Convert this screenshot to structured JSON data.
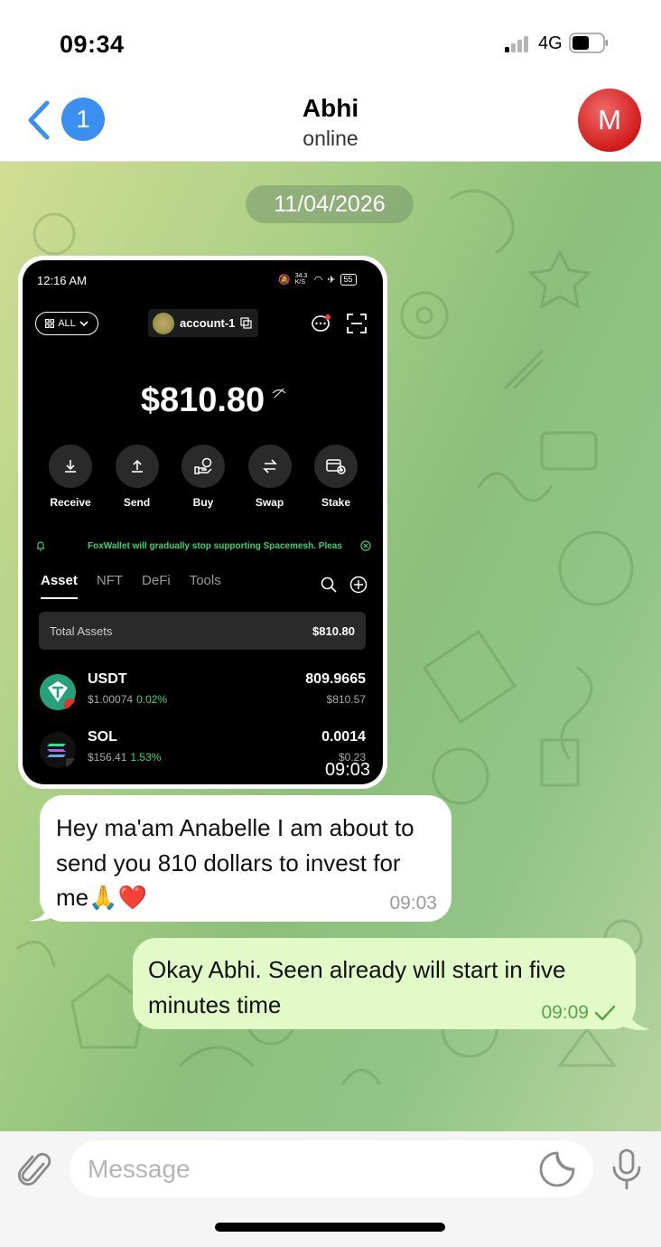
{
  "status_bar": {
    "time": "09:34",
    "network": "4G"
  },
  "header": {
    "back_count": "1",
    "name": "Abhi",
    "status": "online",
    "avatar_letter": "M"
  },
  "date_separator": "11/04/2026",
  "photo_message": {
    "time": "09:03",
    "phone": {
      "time": "12:16 AM",
      "net_speed": "34.3 K/S",
      "battery": "55",
      "filter_label": "ALL",
      "account_name": "account-1",
      "balance": "$810.80",
      "actions": [
        {
          "label": "Receive",
          "icon": "download-icon"
        },
        {
          "label": "Send",
          "icon": "upload-icon"
        },
        {
          "label": "Buy",
          "icon": "buy-icon"
        },
        {
          "label": "Swap",
          "icon": "swap-icon"
        },
        {
          "label": "Stake",
          "icon": "stake-icon"
        }
      ],
      "notice": "FoxWallet will gradually stop supporting Spacemesh. Pleas",
      "tabs": [
        "Asset",
        "NFT",
        "DeFi",
        "Tools"
      ],
      "total_label": "Total Assets",
      "total_value": "$810.80",
      "assets": [
        {
          "name": "USDT",
          "price": "$1.00074",
          "change": "0.02%",
          "amount": "809.9665",
          "value": "$810.57"
        },
        {
          "name": "SOL",
          "price": "$156.41",
          "change": "1.53%",
          "amount": "0.0014",
          "value": "$0.23"
        }
      ]
    }
  },
  "messages": [
    {
      "direction": "incoming",
      "text": "Hey ma'am Anabelle I am about to send you 810 dollars to invest for me🙏❤️",
      "time": "09:03"
    },
    {
      "direction": "outgoing",
      "text": "Okay Abhi. Seen already will start in five minutes time",
      "time": "09:09"
    }
  ],
  "input": {
    "placeholder": "Message"
  },
  "colors": {
    "accent": "#3b8ff0",
    "avatar": "#d11b1b",
    "outgoing_bubble": "#e2f9c8",
    "wallet_green": "#3ed36f"
  }
}
